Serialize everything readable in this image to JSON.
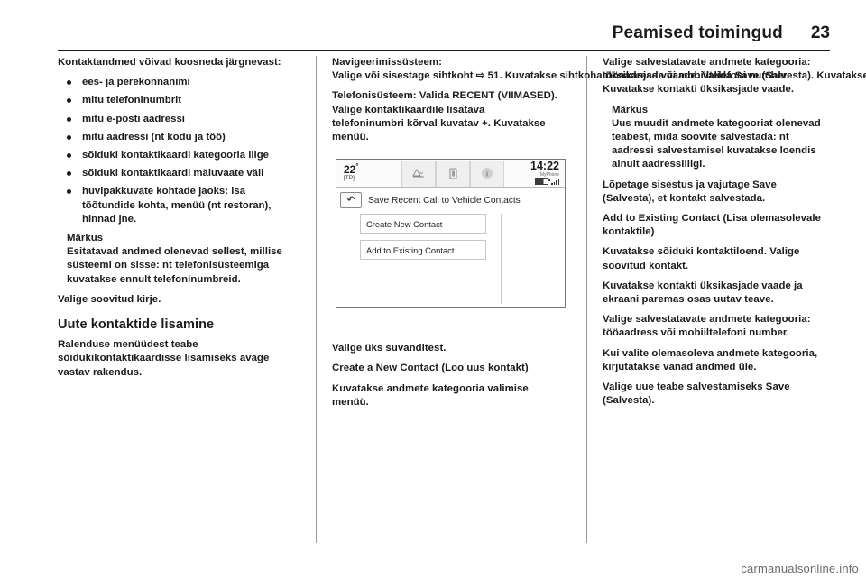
{
  "header": {
    "title": "Peamised toimingud",
    "page_number": "23"
  },
  "column1": {
    "intro": "Kontaktandmed võivad koosneda järgnevast:",
    "bullets": [
      "ees- ja perekonnanimi",
      "mitu telefoninumbrit",
      "mitu e-posti aadressi",
      "mitu aadressi (nt kodu ja töö)",
      "sõiduki kontaktikaardi kategooria liige",
      "sõiduki kontaktikaardi mäluvaate väli",
      "huvipakkuvate kohtade jaoks: isa tõõtundide kohta, menüü (nt restoran), hinnad jne."
    ],
    "note_title": "Märkus",
    "note_body": "Esitatavad andmed olenevad sellest, millise süsteemi on sisse: nt telefonisüsteemiga kuvatakse ennult telefoninumbreid.",
    "after_note": "Valige soovitud kirje.",
    "section_heading": "Uute kontaktide lisamine",
    "section_body": "Ralenduse menüüdest teabe sõidukikontaktikaardisse lisamiseks avage vastav rakendus."
  },
  "column2": {
    "nav_label": "Navigeerimissüsteem:",
    "nav_body": " Valige või sisestage sihtkoht ⇨ 51. Kuvatakse sihtkoha üksikasjade vaade. Valida Save (Salvesta). Kuvatakse menüü.",
    "phone_label": "Telefonisüsteem:",
    "phone_body": " Valida RECENT (VIIMASED). Valige kontaktikaardile lisatava telefoninumbri kõrval kuvatav +. Kuvatakse menüü.",
    "after_figure": "Valige üks suvanditest.",
    "option_title": "Create a New Contact (Loo uus kontakt)",
    "option_body": "Kuvatakse andmete kategooria valimise menüü.",
    "figure": {
      "status_temp": "22",
      "status_temp_unit": "°",
      "status_tp": "[TP]",
      "status_clock": "14:22",
      "status_carrier": "MyPhone",
      "icon_names": [
        "map-icon",
        "phone-book-icon",
        "info-icon"
      ],
      "back_label": "↶",
      "title": "Save Recent Call to Vehicle Contacts",
      "menu_items": [
        "Create New Contact",
        "Add to Existing Contact"
      ]
    }
  },
  "column3": {
    "p1": "Valige salvestatavate andmete kategooria: tööaadress või mobiiltelefoni number. Kuvatakse kontakti üksikasjade vaade.",
    "note_title": "Märkus",
    "note_body": "Uus muudit andmete kategooriat olenevad teabest, mida soovite salvestada: nt aadressi salvestamisel kuvatakse loendis ainult aadressiliigi.",
    "p2": "Lõpetage sisestus ja vajutage Save (Salvesta), et kontakt salvestada.",
    "p3_title": "Add to Existing Contact (Lisa olemasolevale kontaktile)",
    "p3_body": "Kuvatakse sõiduki kontaktiloend. Valige soovitud kontakt.",
    "p4": "Kuvatakse kontakti üksikasjade vaade ja ekraani paremas osas uutav teave.",
    "p5": "Valige salvestatavate andmete kategooria: tööaadress või mobiiltelefoni number.",
    "p6": "Kui valite olemasoleva andmete kategooria, kirjutatakse vanad andmed üle.",
    "p7": "Valige uue teabe salvestamiseks Save (Salvesta)."
  },
  "watermark": "carmanualsonline.info"
}
